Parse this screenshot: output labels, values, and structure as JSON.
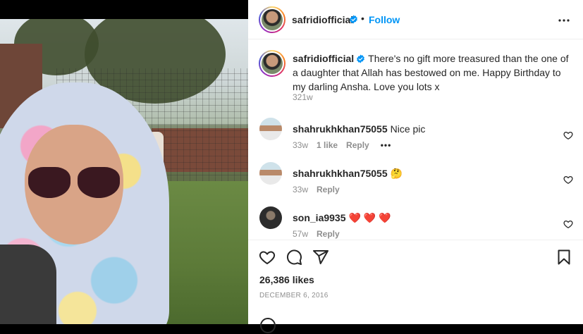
{
  "post": {
    "username": "safridiofficial",
    "follow_label": "Follow",
    "separator": "•",
    "caption": "There's no gift more treasured than the one of a daughter that Allah has bestowed on me. Happy Birthday to my darling Ansha. Love you lots x",
    "caption_time": "321w",
    "likes": "26,386 likes",
    "date": "DECEMBER 6, 2016"
  },
  "comments": [
    {
      "username": "shahrukhkhan75055",
      "text": "Nice pic",
      "time": "33w",
      "likes": "1 like",
      "reply": "Reply",
      "more": "•••"
    },
    {
      "username": "shahrukhkhan75055",
      "text": "🤔",
      "time": "33w",
      "reply": "Reply"
    },
    {
      "username": "son_ia9935",
      "text": "❤️ ❤️ ❤️",
      "time": "57w",
      "reply": "Reply"
    }
  ],
  "colors": {
    "accent": "#0095f6",
    "text": "#262626",
    "muted": "#8e8e8e",
    "heart": "#ed4956"
  },
  "icons": [
    "verified-badge-icon",
    "more-options-icon",
    "heart-icon",
    "comment-icon",
    "share-icon",
    "save-icon"
  ]
}
